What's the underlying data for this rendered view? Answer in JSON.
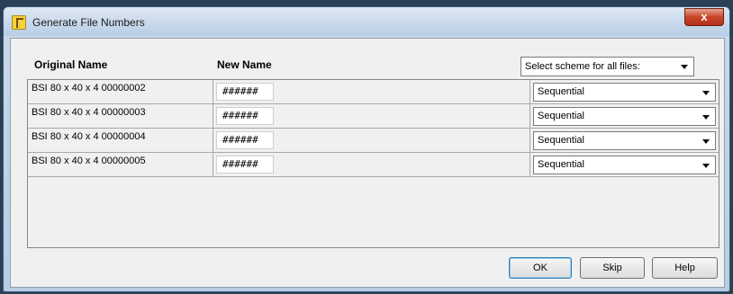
{
  "window": {
    "title": "Generate File Numbers",
    "close_label": "x"
  },
  "table": {
    "columns": [
      "Original Name",
      "New Name"
    ],
    "scheme_all_label": "Select scheme for all files:",
    "rows": [
      {
        "original": "BSI 80 x 40 x 4 00000002",
        "new_name": "######",
        "scheme": "Sequential"
      },
      {
        "original": "BSI 80 x 40 x 4 00000003",
        "new_name": "######",
        "scheme": "Sequential"
      },
      {
        "original": "BSI 80 x 40 x 4 00000004",
        "new_name": "######",
        "scheme": "Sequential"
      },
      {
        "original": "BSI 80 x 40 x 4 00000005",
        "new_name": "######",
        "scheme": "Sequential"
      }
    ]
  },
  "buttons": {
    "ok": "OK",
    "skip": "Skip",
    "help": "Help"
  }
}
